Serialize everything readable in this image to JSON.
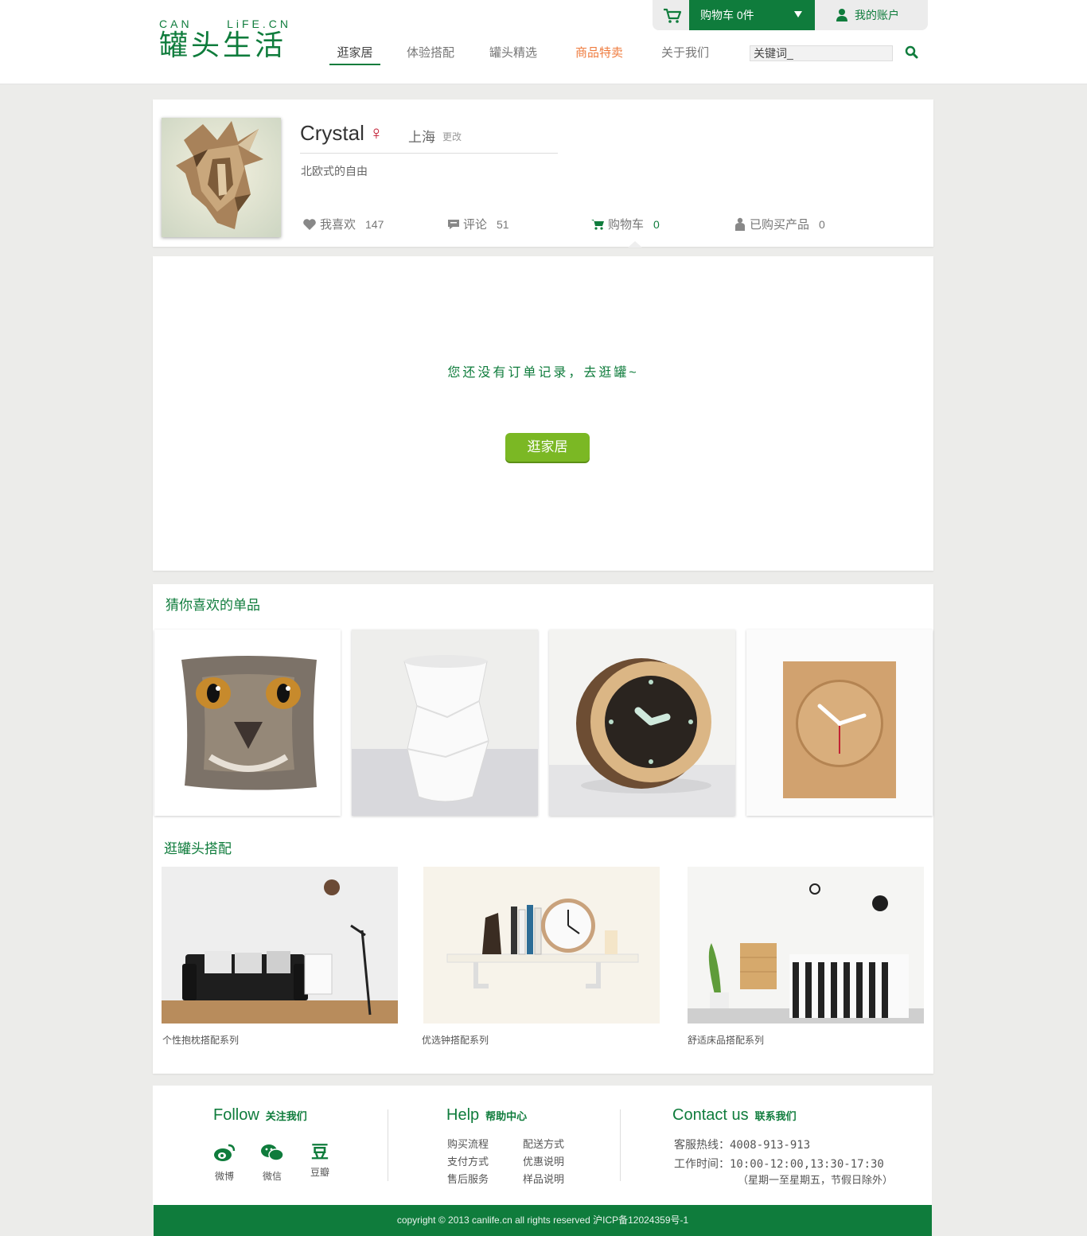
{
  "header": {
    "logo_en_left": "CAN",
    "logo_en_right": "LiFE.CN",
    "logo_cn": "罐头生活",
    "nav": [
      {
        "label": "逛家居",
        "state": "active"
      },
      {
        "label": "体验搭配",
        "state": ""
      },
      {
        "label": "罐头精选",
        "state": ""
      },
      {
        "label": "商品特卖",
        "state": "hot"
      },
      {
        "label": "关于我们",
        "state": ""
      }
    ],
    "search_placeholder": "关键词_",
    "cart_label": "购物车 0件",
    "account_label": "我的账户"
  },
  "profile": {
    "name": "Crystal",
    "gender_symbol": "♀",
    "city": "上海",
    "change_label": "更改",
    "motto": "北欧式的自由",
    "stats": [
      {
        "icon": "heart-icon",
        "label": "我喜欢",
        "value": "147"
      },
      {
        "icon": "comment-icon",
        "label": "评论",
        "value": "51"
      },
      {
        "icon": "cart-icon",
        "label": "购物车",
        "value": "0"
      },
      {
        "icon": "bag-icon",
        "label": "已购买产品",
        "value": "0"
      }
    ]
  },
  "orders": {
    "empty_message": "您还没有订单记录，去逛罐~",
    "button_label": "逛家居"
  },
  "recommend": {
    "title": "猜你喜欢的单品",
    "products": [
      "cat-pillow",
      "white-vase",
      "round-wood-clock",
      "square-wood-clock"
    ]
  },
  "combos": {
    "title": "逛罐头搭配",
    "items": [
      {
        "caption": "个性抱枕搭配系列"
      },
      {
        "caption": "优选钟搭配系列"
      },
      {
        "caption": "舒适床品搭配系列"
      }
    ]
  },
  "footer": {
    "follow_en": "Follow",
    "follow_cn": "关注我们",
    "social": [
      {
        "icon": "weibo-icon",
        "label": "微博"
      },
      {
        "icon": "wechat-icon",
        "label": "微信"
      },
      {
        "icon": "douban-icon",
        "label": "豆瓣",
        "glyph": "豆"
      }
    ],
    "help_en": "Help",
    "help_cn": "帮助中心",
    "help_links": [
      "购买流程",
      "配送方式",
      "支付方式",
      "优惠说明",
      "售后服务",
      "样品说明"
    ],
    "contact_en": "Contact us",
    "contact_cn": "联系我们",
    "hotline": "客服热线：4008-913-913",
    "hours": "工作时间：10:00-12:00,13:30-17:30",
    "hours_note": "（星期一至星期五，节假日除外）",
    "copyright": "copyright © 2013 canlife.cn all rights reserved      沪ICP备12024359号-1"
  },
  "colors": {
    "brand_green": "#0f7c3c",
    "button_green": "#7bb824",
    "hot_orange": "#ef7c3f",
    "female_red": "#c0152c"
  }
}
